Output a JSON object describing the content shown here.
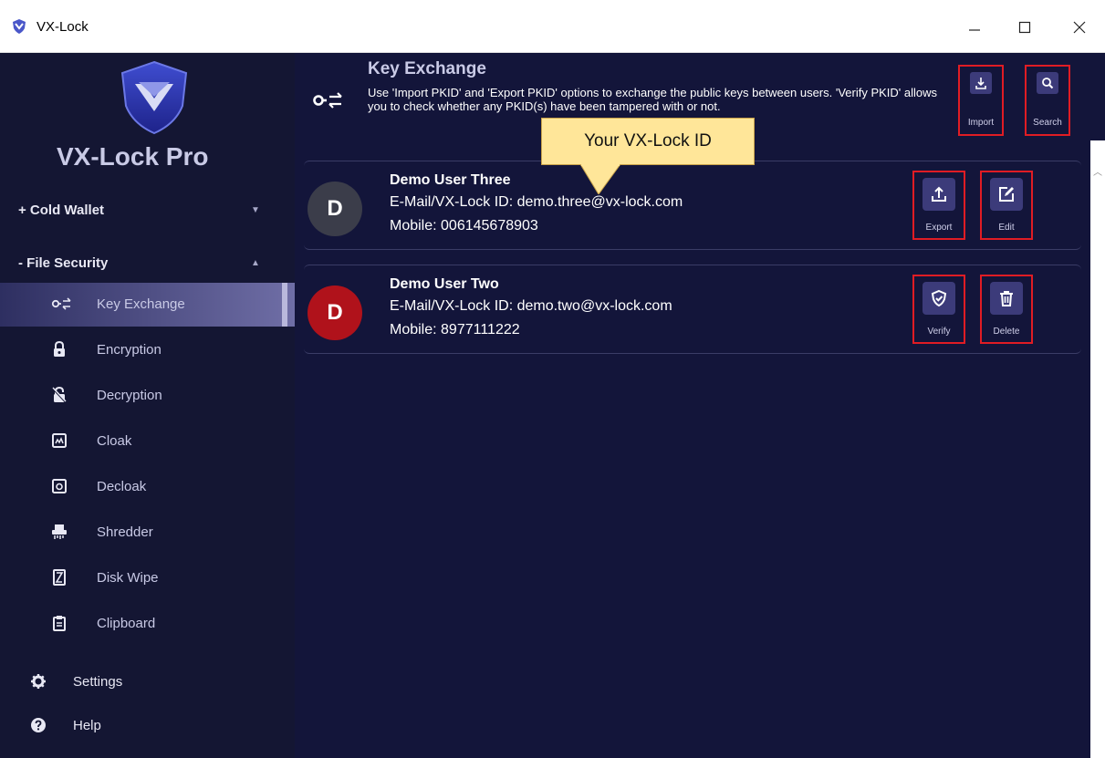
{
  "window": {
    "title": "VX-Lock",
    "controls": {
      "minimize": "–",
      "maximize": "☐",
      "close": "✕"
    }
  },
  "sidebar": {
    "brand": "VX-Lock Pro",
    "sections": [
      {
        "label": "+ Cold Wallet",
        "arrow": "▼"
      },
      {
        "label": "- File Security",
        "arrow": "▲"
      }
    ],
    "items": [
      {
        "label": "Key Exchange",
        "icon": "key-exchange-icon",
        "active": true
      },
      {
        "label": "Encryption",
        "icon": "lock-icon"
      },
      {
        "label": "Decryption",
        "icon": "unlock-icon"
      },
      {
        "label": "Cloak",
        "icon": "cloak-icon"
      },
      {
        "label": "Decloak",
        "icon": "decloak-icon"
      },
      {
        "label": "Shredder",
        "icon": "shredder-icon"
      },
      {
        "label": "Disk Wipe",
        "icon": "disk-wipe-icon"
      },
      {
        "label": "Clipboard",
        "icon": "clipboard-icon"
      }
    ],
    "bottom": [
      {
        "label": "Settings",
        "icon": "gear-icon"
      },
      {
        "label": "Help",
        "icon": "help-icon"
      }
    ]
  },
  "header": {
    "title": "Key Exchange",
    "description": "Use 'Import PKID' and 'Export PKID' options to exchange the public keys between users. 'Verify PKID' allows you to check whether any PKID(s) have been tampered with or not.",
    "buttons": {
      "import": "Import",
      "search": "Search"
    }
  },
  "contacts": [
    {
      "initial": "D",
      "name": "Demo User Three",
      "email": "E-Mail/VX-Lock ID: demo.three@vx-lock.com",
      "mobile": "Mobile: 006145678903",
      "avatar_color": "#3b3d4a",
      "actions": [
        "Export",
        "Edit"
      ]
    },
    {
      "initial": "D",
      "name": "Demo User Two",
      "email": "E-Mail/VX-Lock ID: demo.two@vx-lock.com",
      "mobile": "Mobile: 8977111222",
      "avatar_color": "#b0121b",
      "actions": [
        "Verify",
        "Delete"
      ]
    }
  ],
  "callout": {
    "text": "Your VX-Lock ID"
  },
  "colors": {
    "sidebar_bg": "#141633",
    "main_bg": "#13153a",
    "accent": "#3c3b7a",
    "highlight_border": "#e01c24",
    "callout_bg": "#ffe699"
  }
}
